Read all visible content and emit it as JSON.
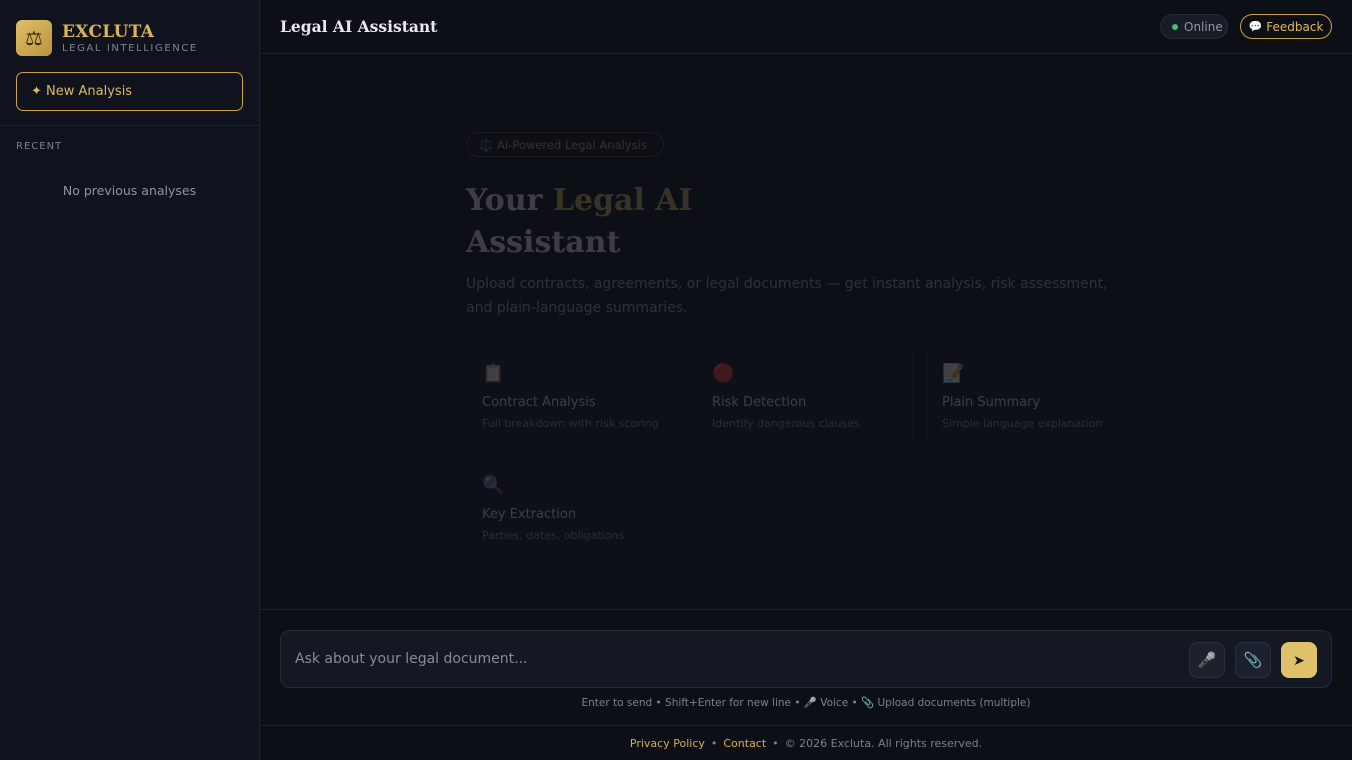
{
  "sidebar": {
    "brand_name": "EXCLUTA",
    "brand_sub": "LEGAL INTELLIGENCE",
    "logo_icon": "⚖",
    "new_analysis_label": "✦ New Analysis",
    "recent_label": "RECENT",
    "empty_label": "No previous analyses"
  },
  "header": {
    "title": "Legal AI Assistant",
    "status": "Online",
    "feedback_icon": "💬",
    "feedback_label": "Feedback"
  },
  "hero": {
    "badge": "⚖️ AI-Powered Legal Analysis",
    "title_prefix": "Your ",
    "title_accent": "Legal AI",
    "title_suffix": "Assistant",
    "subtitle": "Upload contracts, agreements, or legal documents — get instant analysis, risk assessment, and plain-language summaries.",
    "cards": [
      {
        "icon": "📋",
        "title": "Contract Analysis",
        "desc": "Full breakdown with risk scoring"
      },
      {
        "icon": "🔴",
        "title": "Risk Detection",
        "desc": "Identify dangerous clauses"
      },
      {
        "icon": "📝",
        "title": "Plain Summary",
        "desc": "Simple language explanation"
      },
      {
        "icon": "🔍",
        "title": "Key Extraction",
        "desc": "Parties, dates, obligations"
      }
    ]
  },
  "composer": {
    "placeholder": "Ask about your legal document...",
    "mic_icon": "🎤",
    "attach_icon": "📎",
    "send_icon": "➤",
    "hint": "Enter to send • Shift+Enter for new line • 🎤 Voice • 📎 Upload documents (multiple)"
  },
  "footer": {
    "privacy": "Privacy Policy",
    "contact": "Contact",
    "separator": "•",
    "copyright": "© 2026 Excluta. All rights reserved."
  },
  "colors": {
    "accent": "#d9b45a",
    "background": "#0d0f17",
    "online": "#3fbf6f"
  }
}
